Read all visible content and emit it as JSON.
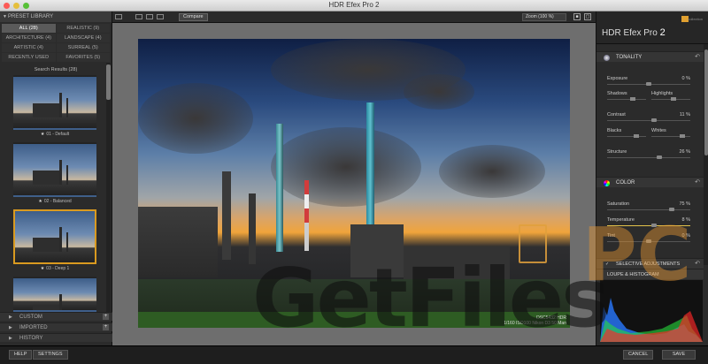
{
  "window": {
    "title": "HDR Efex Pro 2"
  },
  "left_panel": {
    "header": "PRESET LIBRARY",
    "filters": [
      "ALL (28)",
      "REALISTIC (9)",
      "ARCHITECTURE (4)",
      "LANDSCAPE (4)",
      "ARTISTIC (4)",
      "SURREAL (5)",
      "RECENTLY USED",
      "FAVORITES (5)"
    ],
    "results_label": "Search Results (28)",
    "presets": [
      {
        "label": "01 - Default"
      },
      {
        "label": "02 - Balanced"
      },
      {
        "label": "03 - Deep 1"
      },
      {
        "label": ""
      }
    ],
    "sections": [
      {
        "label": "CUSTOM"
      },
      {
        "label": "IMPORTED"
      },
      {
        "label": "HISTORY"
      }
    ]
  },
  "toolbar": {
    "compare_label": "Compare",
    "zoom_label": "Zoom (100 %)"
  },
  "photo": {
    "caption_line1": "DSC5432 HDR",
    "caption_line2": "1/160 ISO100 Nikon D3 50 Man"
  },
  "right_panel": {
    "brand_title": "HDR Efex Pro",
    "brand_version": "2",
    "logo_text": "collection",
    "tonality": {
      "header": "TONALITY",
      "exposure": {
        "label": "Exposure",
        "value": "0 %"
      },
      "shadows": {
        "label": "Shadows"
      },
      "highlights": {
        "label": "Highlights"
      },
      "contrast": {
        "label": "Contrast",
        "value": "11 %"
      },
      "blacks": {
        "label": "Blacks"
      },
      "whites": {
        "label": "Whites"
      },
      "structure": {
        "label": "Structure",
        "value": "26 %"
      }
    },
    "color": {
      "header": "COLOR",
      "saturation": {
        "label": "Saturation",
        "value": "75 %"
      },
      "temperature": {
        "label": "Temperature",
        "value": "8 %"
      },
      "tint": {
        "label": "Tint",
        "value": "0 %"
      }
    },
    "selective_header": "SELECTIVE ADJUSTMENTS",
    "loupe_header": "LOUPE & HISTOGRAM"
  },
  "bottom_bar": {
    "help": "HELP",
    "settings": "SETTINGS",
    "cancel": "CANCEL",
    "save": "SAVE"
  },
  "watermark": {
    "text": "GetFiles",
    "suffix": "PC"
  },
  "colors": {
    "accent": "#d99a20",
    "selected_border": "#d99a20",
    "background": "#2b2b2b"
  }
}
